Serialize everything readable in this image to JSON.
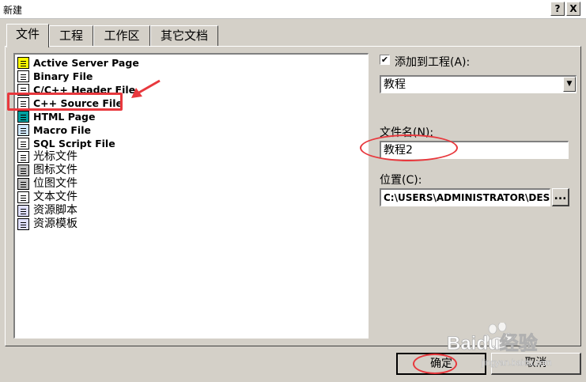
{
  "window": {
    "title": "新建",
    "help_label": "?",
    "close_label": "X"
  },
  "tabs": [
    {
      "label": "文件",
      "active": true
    },
    {
      "label": "工程"
    },
    {
      "label": "工作区"
    },
    {
      "label": "其它文档"
    }
  ],
  "file_types": [
    {
      "label": "Active Server Page",
      "icon": "asp-file-icon"
    },
    {
      "label": "Binary File",
      "icon": "binary-file-icon"
    },
    {
      "label": "C/C++ Header File",
      "icon": "header-file-icon"
    },
    {
      "label": "C++ Source File",
      "icon": "cpp-source-file-icon",
      "highlighted": true
    },
    {
      "label": "HTML Page",
      "icon": "html-page-icon"
    },
    {
      "label": "Macro File",
      "icon": "macro-file-icon"
    },
    {
      "label": "SQL Script File",
      "icon": "sql-script-file-icon"
    },
    {
      "label": "光标文件",
      "icon": "cursor-file-icon"
    },
    {
      "label": "图标文件",
      "icon": "icon-file-icon"
    },
    {
      "label": "位图文件",
      "icon": "bitmap-file-icon"
    },
    {
      "label": "文本文件",
      "icon": "text-file-icon"
    },
    {
      "label": "资源脚本",
      "icon": "resource-script-icon"
    },
    {
      "label": "资源模板",
      "icon": "resource-template-icon"
    }
  ],
  "add_to_project": {
    "label": "添加到工程(A):",
    "checked": true,
    "check_mark": "✔"
  },
  "project_combo": {
    "value": "教程",
    "arrow": "▼"
  },
  "file_name": {
    "label": "文件名(N):",
    "value": "教程2"
  },
  "location": {
    "label": "位置(C):",
    "value": "C:\\USERS\\ADMINISTRATOR\\DES",
    "browse_label": "..."
  },
  "buttons": {
    "ok": "确定",
    "cancel": "取消"
  },
  "watermark": {
    "text": "Baidu经验",
    "sub": "jingyan.baidu.com"
  },
  "annotation_color": "#e8383d"
}
